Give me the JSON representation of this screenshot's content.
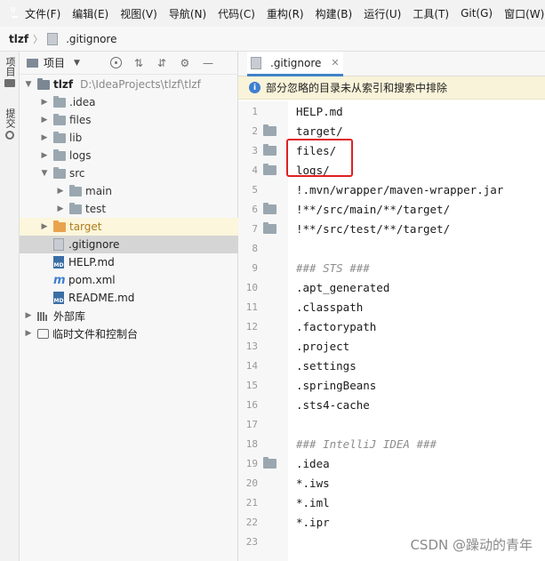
{
  "menubar": {
    "items": [
      "文件(F)",
      "编辑(E)",
      "视图(V)",
      "导航(N)",
      "代码(C)",
      "重构(R)",
      "构建(B)",
      "运行(U)",
      "工具(T)",
      "Git(G)",
      "窗口(W)"
    ]
  },
  "breadcrumb": {
    "project": "tlzf",
    "file": ".gitignore"
  },
  "toolstrip": {
    "project_label": "项目",
    "commit_label": "提交"
  },
  "project_panel": {
    "title": "项目",
    "tree": [
      {
        "label": "tlzf",
        "path": "D:\\IdeaProjects\\tlzf\\tlzf",
        "kind": "root"
      },
      {
        "label": ".idea",
        "kind": "folder"
      },
      {
        "label": "files",
        "kind": "folder"
      },
      {
        "label": "lib",
        "kind": "folder"
      },
      {
        "label": "logs",
        "kind": "folder"
      },
      {
        "label": "src",
        "kind": "folder"
      },
      {
        "label": "main",
        "kind": "folder"
      },
      {
        "label": "test",
        "kind": "folder"
      },
      {
        "label": "target",
        "kind": "excluded-folder"
      },
      {
        "label": ".gitignore",
        "kind": "gitignore"
      },
      {
        "label": "HELP.md",
        "kind": "md"
      },
      {
        "label": "pom.xml",
        "kind": "pom"
      },
      {
        "label": "README.md",
        "kind": "md"
      },
      {
        "label": "外部库",
        "kind": "libraries"
      },
      {
        "label": "临时文件和控制台",
        "kind": "scratches"
      }
    ]
  },
  "editor": {
    "tab_label": ".gitignore",
    "banner": "部分忽略的目录未从索引和搜索中排除",
    "lines": [
      {
        "n": "1",
        "text": "HELP.md"
      },
      {
        "n": "2",
        "text": "target/"
      },
      {
        "n": "3",
        "text": "files/"
      },
      {
        "n": "4",
        "text": "logs/"
      },
      {
        "n": "5",
        "text": "!.mvn/wrapper/maven-wrapper.jar"
      },
      {
        "n": "6",
        "text": "!**/src/main/**/target/"
      },
      {
        "n": "7",
        "text": "!**/src/test/**/target/"
      },
      {
        "n": "8",
        "text": ""
      },
      {
        "n": "9",
        "text": "### STS ###"
      },
      {
        "n": "10",
        "text": ".apt_generated"
      },
      {
        "n": "11",
        "text": ".classpath"
      },
      {
        "n": "12",
        "text": ".factorypath"
      },
      {
        "n": "13",
        "text": ".project"
      },
      {
        "n": "14",
        "text": ".settings"
      },
      {
        "n": "15",
        "text": ".springBeans"
      },
      {
        "n": "16",
        "text": ".sts4-cache"
      },
      {
        "n": "17",
        "text": ""
      },
      {
        "n": "18",
        "text": "### IntelliJ IDEA ###"
      },
      {
        "n": "19",
        "text": ".idea"
      },
      {
        "n": "20",
        "text": "*.iws"
      },
      {
        "n": "21",
        "text": "*.iml"
      },
      {
        "n": "22",
        "text": "*.ipr"
      },
      {
        "n": "23",
        "text": ""
      }
    ]
  },
  "watermark": "CSDN @躁动的青年"
}
